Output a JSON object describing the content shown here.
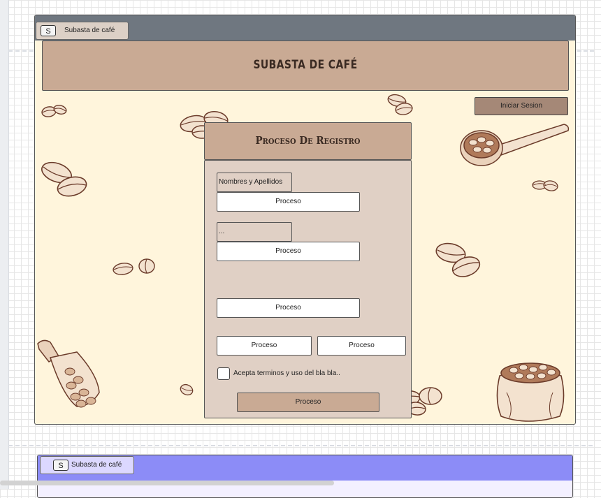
{
  "app": {
    "tab_letter": "S",
    "tab_label": "Subasta de café",
    "page_title": "SUBASTA DE CAFÉ",
    "login_label": "Iniciar Sesion"
  },
  "registration": {
    "title": "Proceso De Registro",
    "name_label": "Nombres y Apellidos",
    "second_label": "...",
    "field1_label": "Proceso",
    "field2_label": "Proceso",
    "field3_label": "Proceso",
    "field4a_label": "Proceso",
    "field4b_label": "Proceso",
    "terms_label": "Acepta terminos y uso del bla bla..",
    "terms_checked": false,
    "submit_label": "Proceso"
  },
  "second_screen": {
    "tab_letter": "S",
    "tab_label": "Subasta de café"
  },
  "colors": {
    "frame_bg": "#fff5dc",
    "header_bg": "#c9aa94",
    "form_bg": "#e0d0c5",
    "login_bg": "#a58877",
    "topbar": "#6f7780",
    "second_topbar": "#8c8cf7"
  },
  "decorations": [
    "coffee-bean-icon",
    "coffee-scoop-icon",
    "coffee-sack-icon"
  ]
}
